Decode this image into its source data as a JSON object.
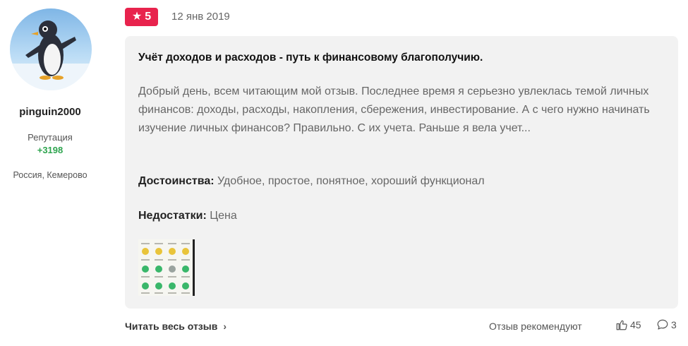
{
  "user": {
    "name": "pinguin2000",
    "reputation_label": "Репутация",
    "reputation_value": "+3198",
    "location": "Россия, Кемерово",
    "avatar_icon": "penguin-avatar"
  },
  "review": {
    "rating": "5",
    "rating_icon": "star-icon",
    "date": "12 янв 2019",
    "title": "Учёт доходов и расходов - путь к финансовому благополучию.",
    "text": "Добрый день, всем читающим мой отзыв. Последнее время я серьезно увлеклась темой личных финансов: доходы, расходы, накопления, сбережения, инвестирование. А с чего нужно начинать изучение личных финансов? Правильно. С их учета. Раньше я вела учет...",
    "pros_label": "Достоинства:",
    "pros_text": "Удобное, простое, понятное, хороший функционал",
    "cons_label": "Недостатки:",
    "cons_text": "Цена"
  },
  "footer": {
    "read_more": "Читать весь отзыв",
    "recommend": "Отзыв рекомендуют",
    "likes": "45",
    "comments": "3"
  },
  "colors": {
    "accent": "#e8234d",
    "reputation": "#2da44e",
    "card_bg": "#f2f2f2"
  }
}
